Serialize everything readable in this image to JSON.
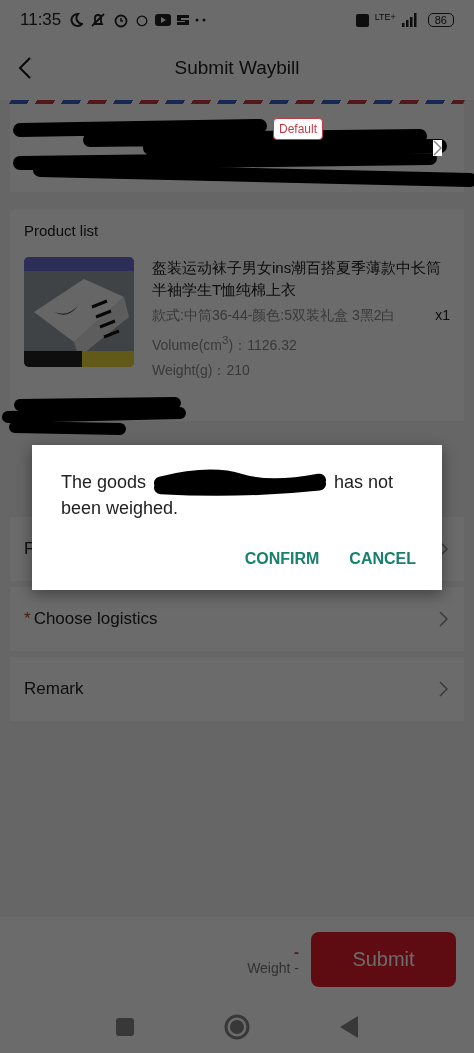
{
  "status_bar": {
    "time": "11:35",
    "network": "LTE+",
    "battery": "86"
  },
  "header": {
    "title": "Submit Waybill"
  },
  "address": {
    "badge": "Default"
  },
  "product_list": {
    "title": "Product list",
    "items": [
      {
        "name": "盔装运动袜子男女ins潮百搭夏季薄款中长筒半袖学生T恤纯棉上衣",
        "spec": "款式:中筒36-44-颜色:5双装礼盒 3黑2白",
        "quantity": "x1",
        "volume": "Volume(cm$^{3}$)：1126.32",
        "weight": "Weight(g)：210"
      }
    ]
  },
  "rows": [
    {
      "label": "F"
    },
    {
      "marker": "*",
      "label": "Choose logistics"
    },
    {
      "label": "Remark"
    }
  ],
  "footer": {
    "amount": "-",
    "weight": "Weight -",
    "button": "Submit"
  },
  "dialog": {
    "message_before": "The goods",
    "message_after": "has not been weighed.",
    "buttons": [
      "CONFIRM",
      "CANCEL"
    ]
  }
}
